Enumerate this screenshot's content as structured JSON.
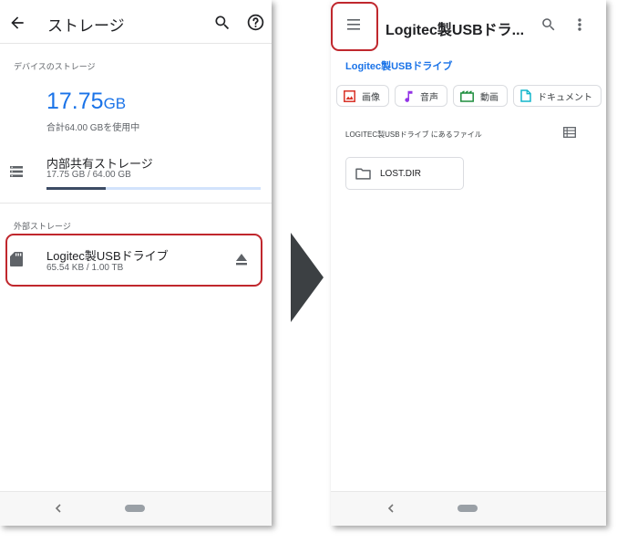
{
  "left_screen": {
    "title": "ストレージ",
    "device_section_label": "デバイスのストレージ",
    "usage_value": "17.75",
    "usage_unit": "GB",
    "usage_sub": "合計64.00 GBを使用中",
    "internal": {
      "title": "内部共有ストレージ",
      "sub": "17.75 GB / 64.00 GB",
      "used_fraction": 0.2773
    },
    "external_section_label": "外部ストレージ",
    "usb": {
      "title": "Logitec製USBドライブ",
      "sub": "65.54 KB / 1.00 TB"
    },
    "icons": [
      "back-arrow-icon",
      "search-icon",
      "help-icon",
      "storage-list-icon",
      "sd-card-icon",
      "eject-icon"
    ]
  },
  "right_screen": {
    "title": "Logitec製USBドラ...",
    "breadcrumb": "Logitec製USBドライブ",
    "chips": [
      {
        "label": "画像",
        "icon": "image-icon",
        "color": "#d93025"
      },
      {
        "label": "音声",
        "icon": "music-note-icon",
        "color": "#9334e6"
      },
      {
        "label": "動画",
        "icon": "video-icon",
        "color": "#1e8e3e"
      },
      {
        "label": "ドキュメント",
        "icon": "document-icon",
        "color": "#12b5cb"
      }
    ],
    "files_label": "LOGITEC製USBドライブ にあるファイル",
    "folder": {
      "name": "LOST.DIR"
    },
    "icons": [
      "menu-icon",
      "search-icon",
      "more-vert-icon",
      "list-view-icon",
      "folder-icon"
    ]
  },
  "colors": {
    "accent_blue": "#1a73e8",
    "highlight_red": "#c0272d",
    "arrow_gray": "#3c4043"
  }
}
